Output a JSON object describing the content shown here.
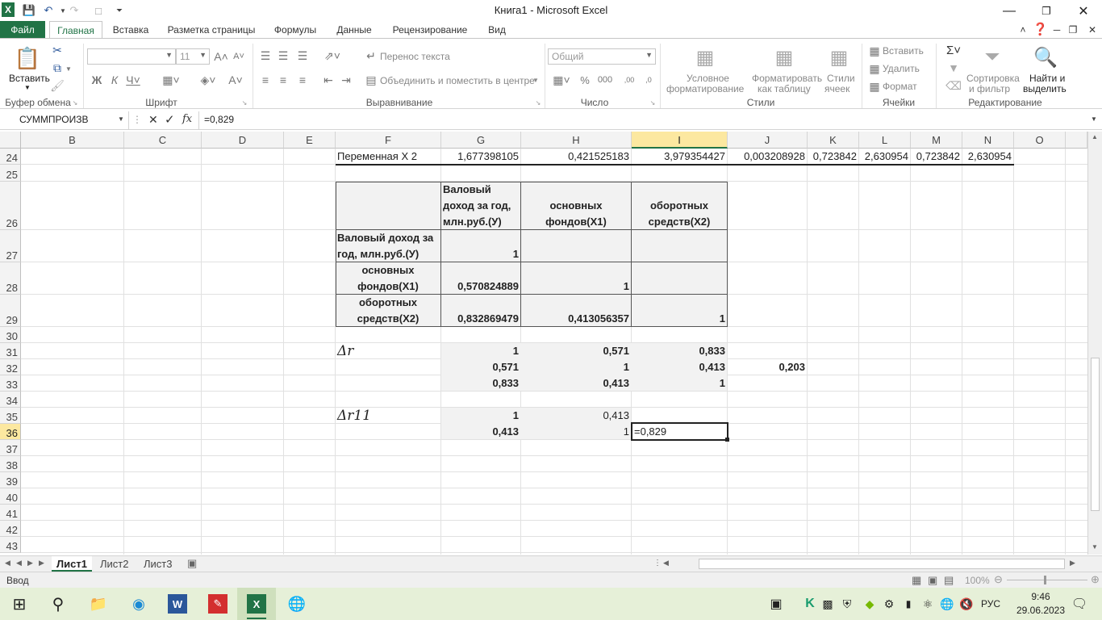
{
  "window": {
    "title": "Книга1 - Microsoft Excel"
  },
  "tabs": [
    "Файл",
    "Главная",
    "Вставка",
    "Разметка страницы",
    "Формулы",
    "Данные",
    "Рецензирование",
    "Вид"
  ],
  "ribbon": {
    "paste": "Вставить",
    "font_name": "",
    "font_size": "11",
    "wrap_text": "Перенос текста",
    "merge_center": "Объединить и поместить в центре",
    "number_format": "Общий",
    "cond_format_1": "Условное",
    "cond_format_2": "форматирование",
    "format_table_1": "Форматировать",
    "format_table_2": "как таблицу",
    "cell_styles_1": "Стили",
    "cell_styles_2": "ячеек",
    "insert": "Вставить",
    "delete": "Удалить",
    "format": "Формат",
    "sort_1": "Сортировка",
    "sort_2": "и фильтр",
    "find_1": "Найти и",
    "find_2": "выделить",
    "groups": {
      "clipboard": "Буфер обмена",
      "font": "Шрифт",
      "alignment": "Выравнивание",
      "number": "Число",
      "styles": "Стили",
      "cells": "Ячейки",
      "editing": "Редактирование"
    }
  },
  "formula_bar": {
    "name_box": "СУММПРОИЗВ",
    "fx": "fx",
    "formula": "=0,829"
  },
  "columns": [
    "B",
    "C",
    "D",
    "E",
    "F",
    "G",
    "H",
    "I",
    "J",
    "K",
    "L",
    "M",
    "N",
    "O"
  ],
  "rows": [
    "24",
    "25",
    "26",
    "27",
    "28",
    "29",
    "30",
    "31",
    "32",
    "33",
    "34",
    "35",
    "36",
    "37",
    "38",
    "39",
    "40",
    "41",
    "42",
    "43"
  ],
  "cells": {
    "r24": [
      "Переменная X 2",
      "1,677398105",
      "0,421525183",
      "3,979354427",
      "0,003208928",
      "0,723842",
      "2,630954",
      "0,723842",
      "2,630954"
    ],
    "r26": {
      "g1": "Валовый",
      "g2": "доход за год,",
      "g3": "млн.руб.(У)",
      "h1": "основных",
      "h2": "фондов(Х1)",
      "i1": "оборотных",
      "i2": "средств(Х2)"
    },
    "r27": {
      "f1": "Валовый доход за",
      "f2": "год, млн.руб.(У)",
      "g": "1"
    },
    "r28": {
      "f1": "основных",
      "f2": "фондов(Х1)",
      "g": "0,570824889",
      "h": "1"
    },
    "r29": {
      "f1": "оборотных",
      "f2": "средств(Х2)",
      "g": "0,832869479",
      "h": "0,413056357",
      "i": "1"
    },
    "r31": {
      "f": "Δr",
      "g": "1",
      "h": "0,571",
      "i": "0,833"
    },
    "r32": {
      "g": "0,571",
      "h": "1",
      "i": "0,413",
      "j": "0,203"
    },
    "r33": {
      "g": "0,833",
      "h": "0,413",
      "i": "1"
    },
    "r35": {
      "f": "Δr11",
      "g": "1",
      "h": "0,413"
    },
    "r36": {
      "g": "0,413",
      "h": "1",
      "i": "=0,829"
    }
  },
  "sheets": [
    "Лист1",
    "Лист2",
    "Лист3"
  ],
  "status": {
    "mode": "Ввод",
    "zoom": "100%"
  },
  "taskbar": {
    "lang": "РУС",
    "time": "9:46",
    "date": "29.06.2023"
  }
}
